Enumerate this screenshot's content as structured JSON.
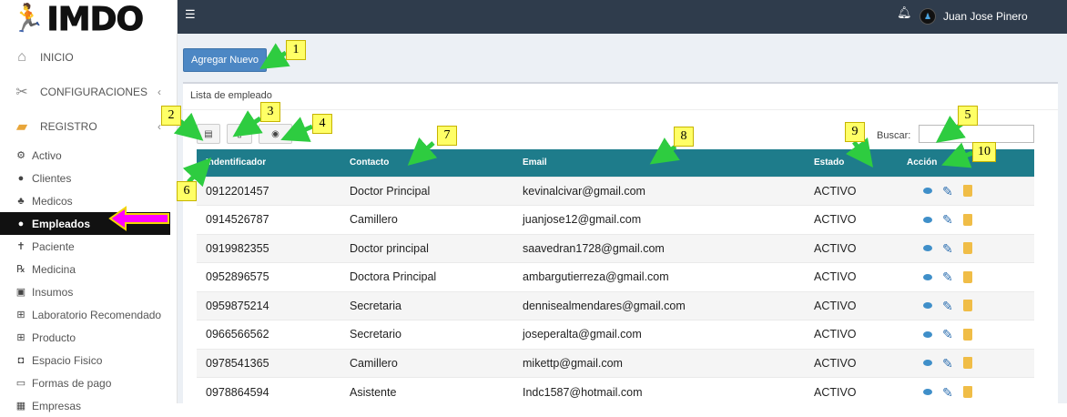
{
  "brand": {
    "logo_text": "IMDO"
  },
  "sidebar": {
    "main": [
      {
        "label": "INICIO",
        "icon": "home-icon"
      },
      {
        "label": "CONFIGURACIONES",
        "icon": "tools-icon"
      },
      {
        "label": "REGISTRO",
        "icon": "register-icon"
      }
    ],
    "sub": [
      {
        "label": "Activo",
        "icon": "cogs-icon"
      },
      {
        "label": "Clientes",
        "icon": "user-icon"
      },
      {
        "label": "Medicos",
        "icon": "doctor-icon"
      },
      {
        "label": "Empleados",
        "icon": "user-icon"
      },
      {
        "label": "Paciente",
        "icon": "patient-icon"
      },
      {
        "label": "Medicina",
        "icon": "medicine-icon"
      },
      {
        "label": "Insumos",
        "icon": "supplies-icon"
      },
      {
        "label": "Laboratorio Recomendado",
        "icon": "plus-square-icon"
      },
      {
        "label": "Producto",
        "icon": "plus-square-icon"
      },
      {
        "label": "Espacio Fisico",
        "icon": "h-square-icon"
      },
      {
        "label": "Formas de pago",
        "icon": "money-icon"
      },
      {
        "label": "Empresas",
        "icon": "building-icon"
      }
    ]
  },
  "topbar": {
    "user_name": "Juan Jose Pinero"
  },
  "page": {
    "add_button": "Agregar Nuevo",
    "card_title": "Lista de empleado",
    "search_label": "Buscar:",
    "search_value": ""
  },
  "table": {
    "headers": [
      "Indentificador",
      "Contacto",
      "Email",
      "Estado",
      "Acción"
    ],
    "rows": [
      [
        "0912201457",
        "Doctor Principal",
        "kevinalcivar@gmail.com",
        "ACTIVO"
      ],
      [
        "0914526787",
        "Camillero",
        "juanjose12@gmail.com",
        "ACTIVO"
      ],
      [
        "0919982355",
        "Doctor principal",
        "saavedran1728@gmail.com",
        "ACTIVO"
      ],
      [
        "0952896575",
        "Doctora Principal",
        "ambargutierreza@gmail.com",
        "ACTIVO"
      ],
      [
        "0959875214",
        "Secretaria",
        "dennisealmendares@gmail.com",
        "ACTIVO"
      ],
      [
        "0966566562",
        "Secretario",
        "joseperalta@gmail.com",
        "ACTIVO"
      ],
      [
        "0978541365",
        "Camillero",
        "mikettp@gmail.com",
        "ACTIVO"
      ],
      [
        "0978864594",
        "Asistente",
        "Indc1587@hotmail.com",
        "ACTIVO"
      ]
    ]
  },
  "annotations": [
    "1",
    "2",
    "3",
    "4",
    "5",
    "6",
    "7",
    "8",
    "9",
    "10"
  ],
  "colors": {
    "topbar": "#2f3c4c",
    "primary_button": "#4c87c4",
    "table_header": "#1e7c8b",
    "callout": "#ffff66",
    "arrow_green": "#2ecc40",
    "arrow_magenta": "#ff00ff"
  }
}
